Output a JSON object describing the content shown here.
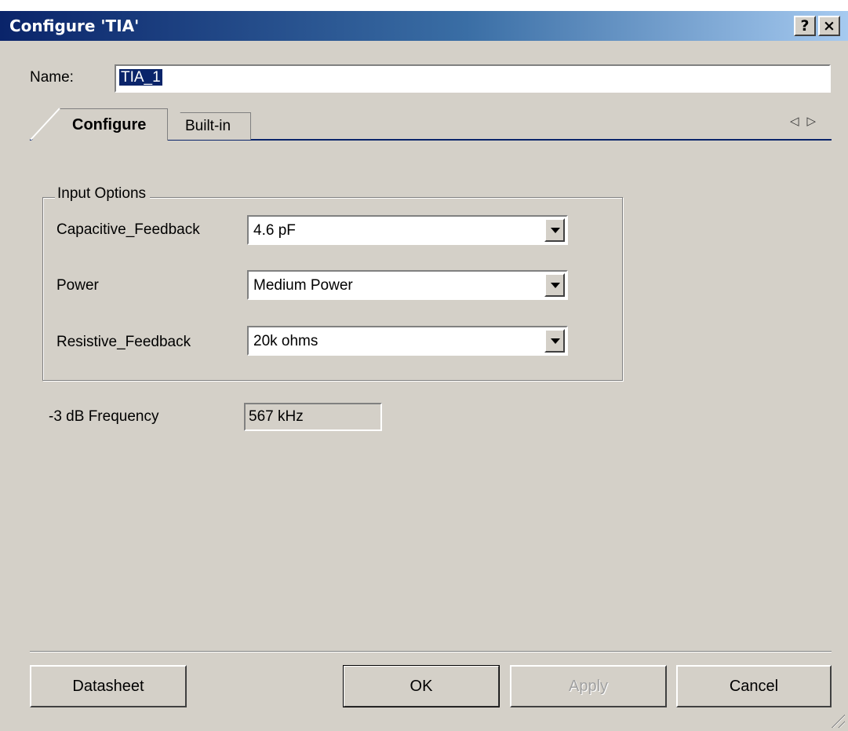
{
  "window": {
    "title": "Configure 'TIA'",
    "help_label": "?",
    "close_label": "×"
  },
  "name_field": {
    "label": "Name:",
    "value": "TIA_1"
  },
  "tabs": [
    {
      "label": "Configure",
      "active": true
    },
    {
      "label": "Built-in",
      "active": false
    }
  ],
  "tab_scroll": {
    "left": "◁",
    "right": "▷"
  },
  "input_options": {
    "title": "Input Options",
    "rows": [
      {
        "label": "Capacitive_Feedback",
        "value": "4.6 pF"
      },
      {
        "label": "Power",
        "value": "Medium Power"
      },
      {
        "label": "Resistive_Feedback",
        "value": "20k ohms"
      }
    ]
  },
  "frequency": {
    "label": "-3 dB Frequency",
    "value": "567 kHz"
  },
  "buttons": {
    "datasheet": "Datasheet",
    "ok": "OK",
    "apply": "Apply",
    "cancel": "Cancel"
  },
  "colors": {
    "face": "#d4d0c8",
    "titlebar_start": "#0a246a",
    "titlebar_end": "#a6caf0"
  }
}
